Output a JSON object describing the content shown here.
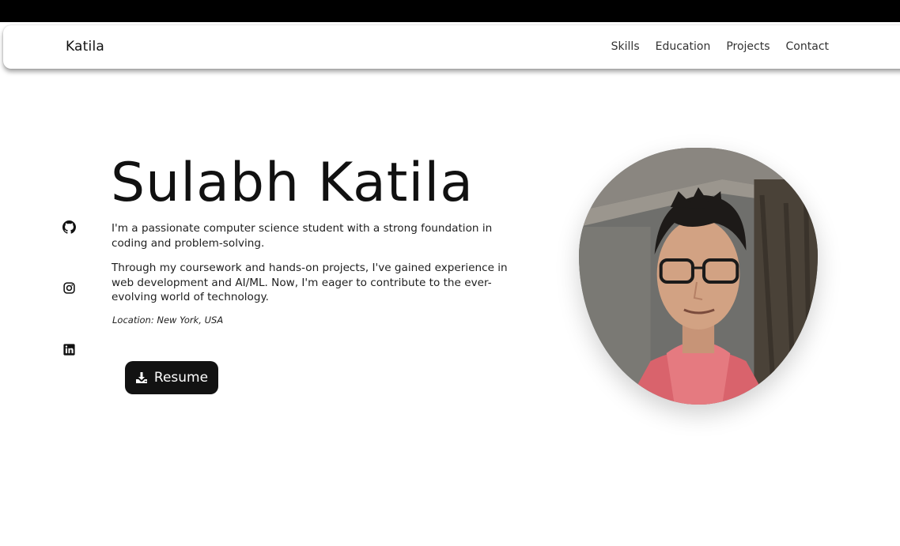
{
  "nav": {
    "brand": "Katila",
    "links": [
      "Skills",
      "Education",
      "Projects",
      "Contact"
    ]
  },
  "hero": {
    "name": "Sulabh Katila",
    "paragraph1": "I'm a passionate computer science student with a strong foundation in coding and problem-solving.",
    "paragraph2": "Through my coursework and hands-on projects, I've gained experience in web development and AI/ML. Now, I'm eager to contribute to the ever-evolving world of technology.",
    "location": "Location: New York, USA",
    "resume_label": "Resume"
  },
  "social": {
    "icons": [
      "github-icon",
      "instagram-icon",
      "linkedin-icon"
    ]
  },
  "colors": {
    "topbar": "#000000",
    "button_bg": "#121212",
    "text": "#1a1a1a",
    "background": "#ffffff"
  }
}
